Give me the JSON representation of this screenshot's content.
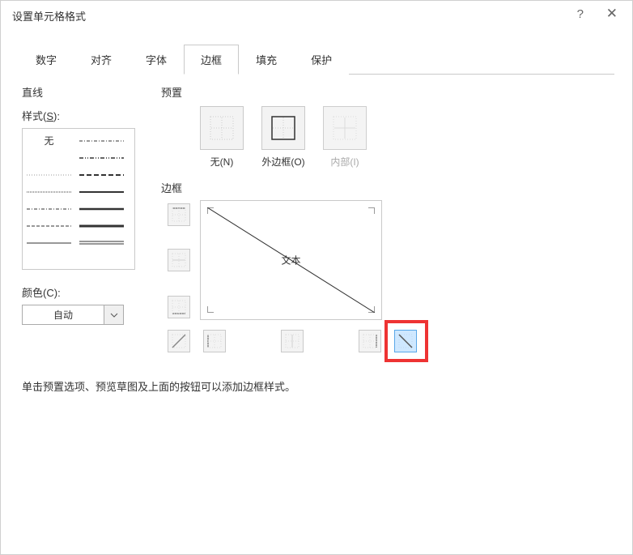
{
  "title": "设置单元格格式",
  "help_label": "?",
  "close_label": "✕",
  "tabs": [
    "数字",
    "对齐",
    "字体",
    "边框",
    "填充",
    "保护"
  ],
  "active_tab": "边框",
  "line": {
    "group": "直线",
    "style_label_prefix": "样式(",
    "style_label_key": "S",
    "style_label_suffix": "):",
    "none": "无",
    "color_label_prefix": "颜色(",
    "color_label_key": "C",
    "color_label_suffix": "):",
    "color_value": "自动"
  },
  "preset": {
    "group": "预置",
    "none": "无(N)",
    "outer": "外边框(O)",
    "inner": "内部(I)"
  },
  "border": {
    "group": "边框",
    "preview_text": "文本"
  },
  "hint": "单击预置选项、预览草图及上面的按钮可以添加边框样式。"
}
